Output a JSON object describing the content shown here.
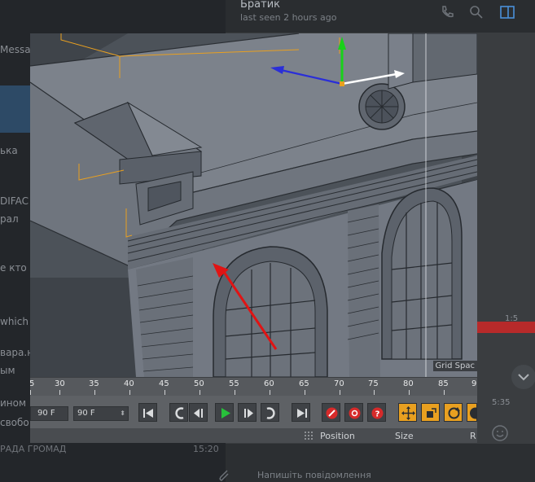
{
  "chat": {
    "peer_name": "Братик",
    "peer_status": "last seen 2 hours ago",
    "composer_placeholder": "Напишіть повідомлення",
    "left_items": [
      "Messa",
      "ька",
      "DIFAC",
      "рал",
      "е кто",
      "which",
      "вара.н",
      "ым",
      "ином",
      "свобо"
    ],
    "bottom_left_text": "РАДА ГРОМАД",
    "bottom_time": "15:20",
    "right_time_1": "1:5",
    "right_time_2": "5:35"
  },
  "viewport": {
    "grid_label": "Grid Spac"
  },
  "timeline": {
    "ticks": [
      "5",
      "30",
      "35",
      "40",
      "45",
      "50",
      "55",
      "60",
      "65",
      "70",
      "75",
      "80",
      "85",
      "9"
    ]
  },
  "controls": {
    "frame_field_1": "90 F",
    "frame_field_2": "90 F",
    "buttons": [
      "go-to-start",
      "previous-key",
      "previous-frame",
      "play-forward",
      "next-frame",
      "next-key",
      "go-to-end",
      "record-active",
      "autokeying",
      "keyframe-selection",
      "move-tool",
      "scale-tool",
      "rotate-tool",
      "parameter"
    ]
  },
  "attributes": {
    "position_label": "Position",
    "size_label": "Size",
    "rotation_label": "R"
  },
  "colors": {
    "axis_y": "#19d11a",
    "axis_x": "#2a2ed8",
    "annotation_arrow": "#e01414",
    "selection_box": "#e9a020",
    "play_button": "#27c13b",
    "record_button": "#d62a2a"
  }
}
